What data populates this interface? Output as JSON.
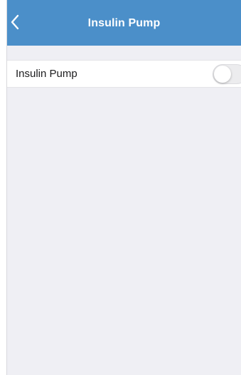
{
  "header": {
    "title": "Insulin Pump",
    "back_icon": "chevron-left-icon"
  },
  "settings": {
    "rows": [
      {
        "label": "Insulin Pump",
        "toggle_on": false
      }
    ]
  },
  "colors": {
    "nav_bar": "#4b8fc9",
    "background": "#efeff4",
    "row_background": "#ffffff",
    "toggle_off": "#ececee"
  }
}
